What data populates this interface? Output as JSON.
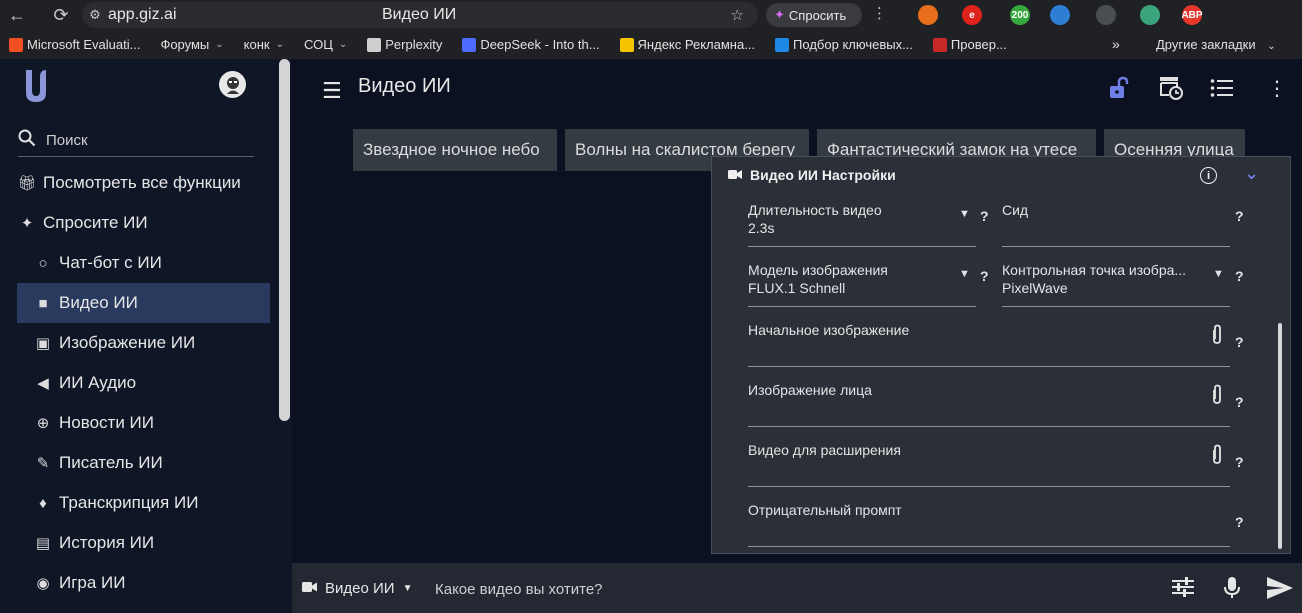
{
  "browser": {
    "url": "app.giz.ai",
    "page_title": "Видео ИИ",
    "ask_button": "Спросить",
    "extensions": [
      {
        "name": "firefox-like-icon",
        "color": "#e86f1b",
        "label": ""
      },
      {
        "name": "e-extension-icon",
        "color": "#e0221c",
        "label": "e"
      },
      {
        "name": "counter-extension-icon",
        "color": "#38a83e",
        "label": "200"
      },
      {
        "name": "puzzle-extension-icon",
        "color": "#2d7fd3",
        "label": ""
      },
      {
        "name": "wrench-extension-icon",
        "color": "#4a4d52",
        "label": ""
      },
      {
        "name": "gem-extension-icon",
        "color": "#3aa57d",
        "label": ""
      },
      {
        "name": "adblock-extension-icon",
        "color": "#e6372c",
        "label": "ABP"
      },
      {
        "name": "reading-list-icon",
        "color": "#202124",
        "label": ""
      },
      {
        "name": "download-icon",
        "color": "#202124",
        "label": ""
      }
    ],
    "bookmarks": [
      {
        "label": "Microsoft Evaluati...",
        "fav": "#f25022",
        "folder": false
      },
      {
        "label": "Форумы",
        "fav": "",
        "folder": true
      },
      {
        "label": "конк",
        "fav": "",
        "folder": true
      },
      {
        "label": "СОЦ",
        "fav": "",
        "folder": true
      },
      {
        "label": "Perplexity",
        "fav": "#cfcfcf",
        "folder": false
      },
      {
        "label": "DeepSeek - Into th...",
        "fav": "#4d6bfe",
        "folder": false
      },
      {
        "label": "Яндекс Рекламна...",
        "fav": "#f5c400",
        "folder": false
      },
      {
        "label": "Подбор ключевых...",
        "fav": "#1e88e5",
        "folder": false
      },
      {
        "label": "Провер...",
        "fav": "#c62828",
        "folder": false
      }
    ],
    "bookmarks_more": "»",
    "other_bookmarks": "Другие закладки"
  },
  "sidebar": {
    "search_placeholder": "Поиск",
    "items": [
      {
        "label": "Посмотреть все функции",
        "icon": "gift-icon",
        "sub": false,
        "active": false
      },
      {
        "label": "Спросите ИИ",
        "icon": "sparkle-icon",
        "sub": false,
        "active": false
      },
      {
        "label": "Чат-бот с ИИ",
        "icon": "chat-bubble-icon",
        "sub": true,
        "active": false
      },
      {
        "label": "Видео ИИ",
        "icon": "video-camera-icon",
        "sub": true,
        "active": true
      },
      {
        "label": "Изображение ИИ",
        "icon": "image-plus-icon",
        "sub": true,
        "active": false
      },
      {
        "label": "ИИ Аудио",
        "icon": "speaker-icon",
        "sub": true,
        "active": false
      },
      {
        "label": "Новости ИИ",
        "icon": "globe-icon",
        "sub": true,
        "active": false
      },
      {
        "label": "Писатель ИИ",
        "icon": "pen-icon",
        "sub": true,
        "active": false
      },
      {
        "label": "Транскрипция ИИ",
        "icon": "microphone-icon",
        "sub": true,
        "active": false
      },
      {
        "label": "История ИИ",
        "icon": "book-icon",
        "sub": true,
        "active": false
      },
      {
        "label": "Игра ИИ",
        "icon": "gamepad-icon",
        "sub": true,
        "active": false
      }
    ]
  },
  "main": {
    "title": "Видео ИИ",
    "chips": [
      "Звездное ночное небо",
      "Волны на скалистом берегу",
      "Фантастический замок на утесе",
      "Осенняя улица"
    ]
  },
  "settings": {
    "title": "Видео ИИ Настройки",
    "fields": {
      "duration": {
        "label": "Длительность видео",
        "value": "2.3s"
      },
      "seed": {
        "label": "Сид",
        "value": ""
      },
      "image_model": {
        "label": "Модель изображения",
        "value": "FLUX.1 Schnell"
      },
      "checkpoint": {
        "label": "Контрольная точка изобра...",
        "value": "PixelWave"
      },
      "start_image": {
        "label": "Начальное изображение"
      },
      "face_image": {
        "label": "Изображение лица"
      },
      "extend_video": {
        "label": "Видео для расширения"
      },
      "negative_prompt": {
        "label": "Отрицательный промпт"
      }
    },
    "help": "?"
  },
  "bottom": {
    "mode_label": "Видео ИИ",
    "prompt_placeholder": "Какое видео вы хотите?"
  }
}
